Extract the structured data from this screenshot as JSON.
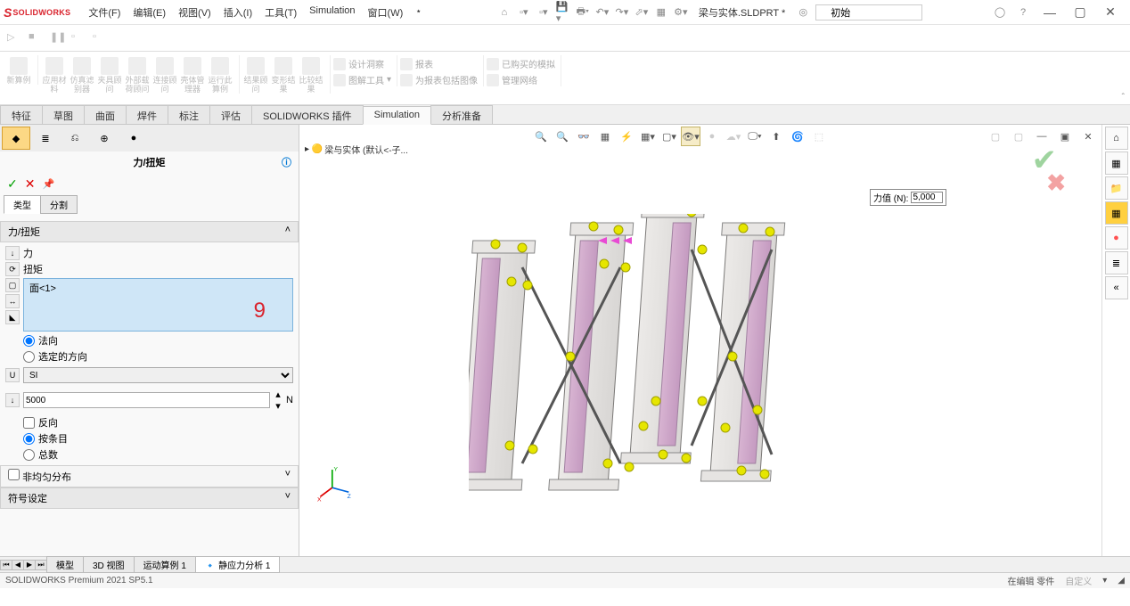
{
  "app": {
    "brand_prefix": "S",
    "brand_rest": "SOLIDWORKS"
  },
  "menu": {
    "file": "文件(F)",
    "edit": "编辑(E)",
    "view": "视图(V)",
    "insert": "插入(I)",
    "tools": "工具(T)",
    "simulation": "Simulation",
    "window": "窗口(W)"
  },
  "doc": {
    "name": "梁与实体.SLDPRT *"
  },
  "search": {
    "value": "初始"
  },
  "ribbon": {
    "g1": {
      "new_study": "新算例"
    },
    "g2": {
      "apply_material": "应用材料",
      "sim_advisor": "仿真滤别器",
      "fixture_advisor": "夹具顾问",
      "ext_load_advisor": "外部载荷顾问",
      "conn_advisor": "连接顾问",
      "shell_mgr": "壳体管理器",
      "run_study": "运行此算例"
    },
    "g3": {
      "result_advisor": "结果顾问",
      "deformed": "变形结果",
      "compare": "比较结果"
    },
    "row": {
      "design_insight": "设计洞察",
      "image_tools": "图解工具",
      "report": "报表",
      "incl_img": "为报表包括图像",
      "got_sim": "已购买的模拟",
      "manage_net": "管理网络"
    }
  },
  "tabs": {
    "feature": "特征",
    "sketch": "草图",
    "surface": "曲面",
    "weldment": "焊件",
    "annotate": "标注",
    "evaluate": "评估",
    "sw_addins": "SOLIDWORKS 插件",
    "simulation": "Simulation",
    "analysis_prep": "分析准备"
  },
  "tree_stub": "梁与实体  (默认<-子...",
  "panel": {
    "title": "力/扭矩",
    "subtabs": {
      "type": "类型",
      "split": "分割"
    },
    "section_force": "力/扭矩",
    "force": "力",
    "torque": "扭矩",
    "face1": "面<1>",
    "overlay_number": "9",
    "normal": "法向",
    "selected_dir": "选定的方向",
    "unit_sys": "SI",
    "value": "5000",
    "unit": "N",
    "reverse": "反向",
    "per_item": "按条目",
    "total": "总数",
    "nonuniform": "非均匀分布",
    "symbol_settings": "符号设定"
  },
  "vp_label": {
    "name": "力值  (N):",
    "value": "5,000"
  },
  "bottom_tabs": {
    "model": "模型",
    "view3d": "3D 视图",
    "motion": "运动算例 1",
    "static": "静应力分析 1"
  },
  "status": {
    "product": "SOLIDWORKS Premium 2021 SP5.1",
    "editing": "在编辑 零件",
    "custom": "自定义"
  }
}
